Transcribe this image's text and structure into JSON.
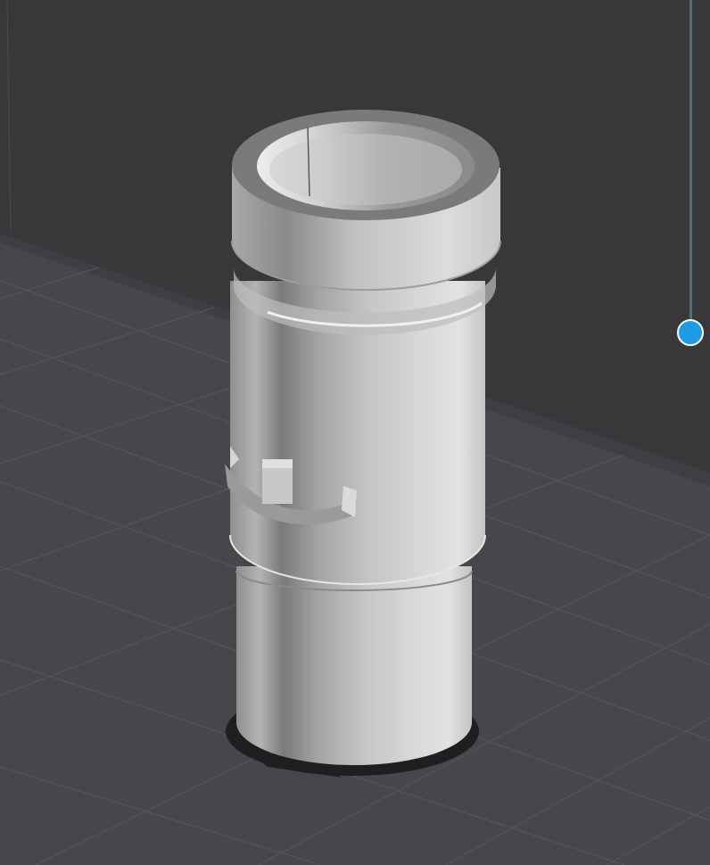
{
  "scene": {
    "background_wall_color": "#38383b",
    "floor_color": "#47474b",
    "grid_line_color": "#5a5a5f",
    "model_color": "#bdbdbd",
    "shadow_color": "#1f1f21"
  },
  "model": {
    "name": "cylinder-tube-part"
  },
  "layer_slider": {
    "accent": "#1e9be6",
    "value": 0.62
  }
}
